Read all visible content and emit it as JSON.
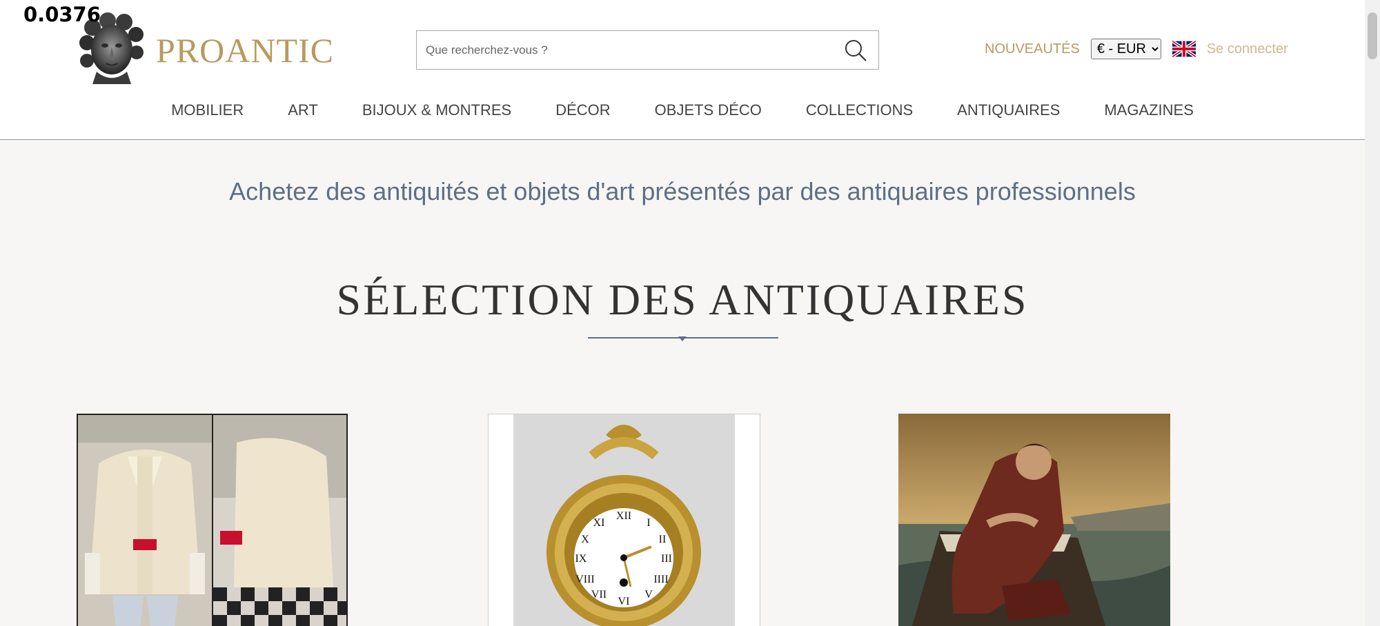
{
  "overlay": {
    "value": "0.0376"
  },
  "header": {
    "logo_text": "PROANTIC",
    "search": {
      "placeholder": "Que recherchez-vous ?",
      "value": ""
    },
    "new_label": "NOUVEAUTÉS",
    "currency": {
      "selected": "€ - EUR",
      "options": [
        "€ - EUR"
      ]
    },
    "language_flag": "uk-flag-icon",
    "login_label": "Se connecter"
  },
  "nav": {
    "items": [
      "MOBILIER",
      "ART",
      "BIJOUX & MONTRES",
      "DÉCOR",
      "OBJETS DÉCO",
      "COLLECTIONS",
      "ANTIQUAIRES",
      "MAGAZINES"
    ]
  },
  "main": {
    "tagline": "Achetez des antiquités et objets d'art présentés par des antiquaires professionnels",
    "section_title": "SÉLECTION DES ANTIQUAIRES"
  },
  "colors": {
    "brand_gold": "#b89a5f",
    "accent_blue_grey": "#5d6f86",
    "background": "#f7f6f4"
  }
}
